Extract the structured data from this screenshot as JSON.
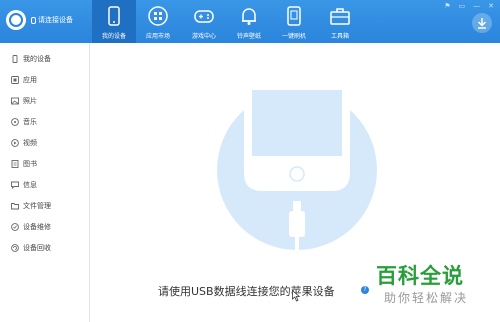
{
  "app": {
    "connect_status": "请连接设备",
    "window_controls": [
      "⚑",
      "▭",
      "—",
      "✕"
    ]
  },
  "tabs": [
    {
      "label": "我的设备",
      "icon": "phone-icon",
      "active": true
    },
    {
      "label": "应用市场",
      "icon": "app-store-icon",
      "active": false
    },
    {
      "label": "游戏中心",
      "icon": "gamepad-icon",
      "active": false
    },
    {
      "label": "铃声壁纸",
      "icon": "bell-icon",
      "active": false
    },
    {
      "label": "一键刷机",
      "icon": "flash-phone-icon",
      "active": false
    },
    {
      "label": "工具箱",
      "icon": "toolbox-icon",
      "active": false
    }
  ],
  "sidebar": {
    "items": [
      {
        "label": "我的设备",
        "icon": "device-icon"
      },
      {
        "label": "应用",
        "icon": "app-icon"
      },
      {
        "label": "照片",
        "icon": "photo-icon"
      },
      {
        "label": "音乐",
        "icon": "music-icon"
      },
      {
        "label": "视频",
        "icon": "video-icon"
      },
      {
        "label": "图书",
        "icon": "book-icon"
      },
      {
        "label": "信息",
        "icon": "message-icon"
      },
      {
        "label": "文件管理",
        "icon": "folder-icon"
      },
      {
        "label": "设备维修",
        "icon": "repair-icon"
      },
      {
        "label": "设备回收",
        "icon": "recycle-icon"
      }
    ]
  },
  "main": {
    "prompt": "请使用USB数据线连接您的苹果设备",
    "help_symbol": "?"
  },
  "watermark": {
    "title": "百科全说",
    "subtitle": "助你轻松解决"
  },
  "colors": {
    "accent": "#2a85dc",
    "active_tab": "#1f6fc2",
    "illustration_circle": "#d6e9fb",
    "watermark_green": "#2a9e3a"
  }
}
